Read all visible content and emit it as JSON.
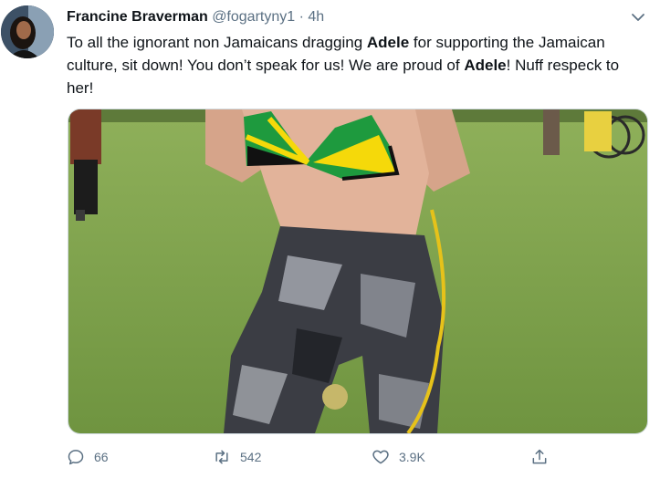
{
  "tweet": {
    "author_name": "Francine Braverman",
    "author_handle": "@fogartyny1",
    "separator": "·",
    "time": "4h",
    "text_segments": [
      {
        "text": "To all the ignorant non Jamaicans dragging ",
        "bold": false
      },
      {
        "text": "Adele",
        "bold": true
      },
      {
        "text": " for supporting the Jamaican culture, sit down! You don’t speak for us! We are proud of ",
        "bold": false
      },
      {
        "text": "Adele",
        "bold": true
      },
      {
        "text": "! Nuff respeck to her!",
        "bold": false
      }
    ]
  },
  "actions": {
    "reply_count": "66",
    "retweet_count": "542",
    "like_count": "3.9K"
  },
  "icons": {
    "avatar": "avatar",
    "more": "chevron-down-icon",
    "reply": "reply-icon",
    "retweet": "retweet-icon",
    "like": "heart-icon",
    "share": "share-icon"
  },
  "colors": {
    "secondary_text": "#5b7083",
    "bikini_green": "#1e9a3e",
    "bikini_yellow": "#f5d90a",
    "grass": "#7ea24a"
  }
}
